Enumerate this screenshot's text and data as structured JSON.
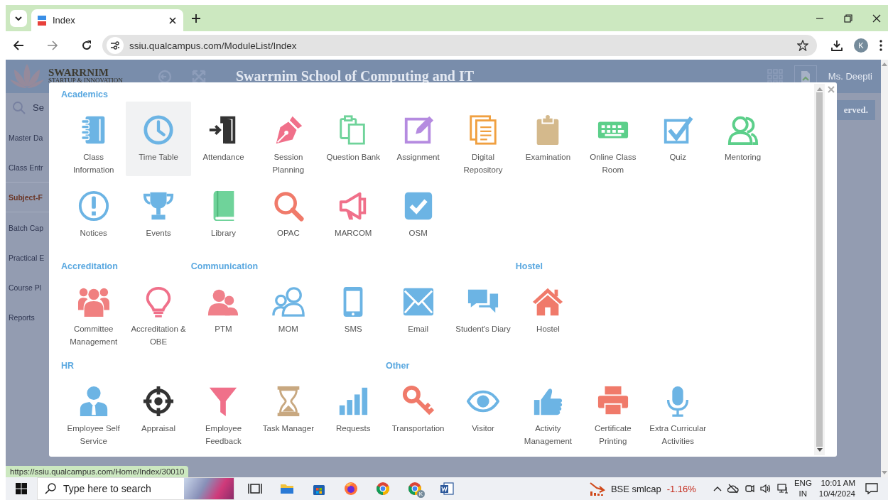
{
  "browser": {
    "tabs": [
      {
        "title": "Index",
        "selected": true
      }
    ],
    "url": "ssiu.qualcampus.com/ModuleList/Index",
    "profile_initial": "K",
    "status_url": "https://ssiu.qualcampus.com/Home/Index/30010"
  },
  "background_page": {
    "logo_text": "SWARRNIM",
    "logo_subtitle": "STARTUP & INNOVATION",
    "title": "Swarrnim School of Computing and IT",
    "user": "Ms. Deepti",
    "search_placeholder": "Se",
    "menu": [
      {
        "label": "Master Da",
        "selected": false
      },
      {
        "label": "Class Entr",
        "selected": false
      },
      {
        "label": "Subject-F",
        "selected": true
      },
      {
        "label": "Batch Cap",
        "selected": false
      },
      {
        "label": "Practical E",
        "selected": false
      },
      {
        "label": "Course Pl",
        "selected": false
      },
      {
        "label": "Reports",
        "selected": false
      }
    ],
    "footer_fragment": "erved."
  },
  "module_dialog": {
    "section_rows": [
      {
        "sections": [
          {
            "title": "Academics",
            "items": [
              {
                "label": "Class Information",
                "selected": false
              },
              {
                "label": "Time Table",
                "selected": true
              },
              {
                "label": "Attendance",
                "selected": false
              },
              {
                "label": "Session Planning",
                "selected": false
              },
              {
                "label": "Question Bank",
                "selected": false
              },
              {
                "label": "Assignment",
                "selected": false
              },
              {
                "label": "Digital Repository",
                "selected": false
              },
              {
                "label": "Examination",
                "selected": false
              },
              {
                "label": "Online Class Room",
                "selected": false
              },
              {
                "label": "Quiz",
                "selected": false
              },
              {
                "label": "Mentoring",
                "selected": false
              },
              {
                "label": "Notices",
                "selected": false
              },
              {
                "label": "Events",
                "selected": false
              },
              {
                "label": "Library",
                "selected": false
              },
              {
                "label": "OPAC",
                "selected": false
              },
              {
                "label": "MARCOM",
                "selected": false
              },
              {
                "label": "OSM",
                "selected": false
              }
            ]
          }
        ]
      },
      {
        "sections": [
          {
            "title": "Accreditation",
            "items": [
              {
                "label": "Committee Management",
                "selected": false
              },
              {
                "label": "Accreditation & OBE",
                "selected": false
              }
            ]
          },
          {
            "title": "Communication",
            "items": [
              {
                "label": "PTM",
                "selected": false
              },
              {
                "label": "MOM",
                "selected": false
              },
              {
                "label": "SMS",
                "selected": false
              },
              {
                "label": "Email",
                "selected": false
              },
              {
                "label": "Student's Diary",
                "selected": false
              }
            ]
          },
          {
            "title": "Hostel",
            "items": [
              {
                "label": "Hostel",
                "selected": false
              }
            ]
          }
        ]
      },
      {
        "sections": [
          {
            "title": "HR",
            "items": [
              {
                "label": "Employee Self Service",
                "selected": false
              },
              {
                "label": "Appraisal",
                "selected": false
              },
              {
                "label": "Employee Feedback",
                "selected": false
              },
              {
                "label": "Task Manager",
                "selected": false
              },
              {
                "label": "Requests",
                "selected": false
              }
            ]
          },
          {
            "title": "Other",
            "items": [
              {
                "label": "Transportation",
                "selected": false
              },
              {
                "label": "Visitor",
                "selected": false
              },
              {
                "label": "Activity Management",
                "selected": false
              },
              {
                "label": "Certificate Printing",
                "selected": false
              },
              {
                "label": "Extra Curricular Activities",
                "selected": false
              }
            ]
          }
        ]
      }
    ]
  },
  "taskbar": {
    "search_placeholder": "Type here to search",
    "ticker_name": "BSE smlcap",
    "ticker_change": "-1.16%",
    "language": "ENG",
    "region": "IN",
    "time": "10:01 AM",
    "date": "10/4/2024",
    "chrome_profile_initial": "K"
  }
}
